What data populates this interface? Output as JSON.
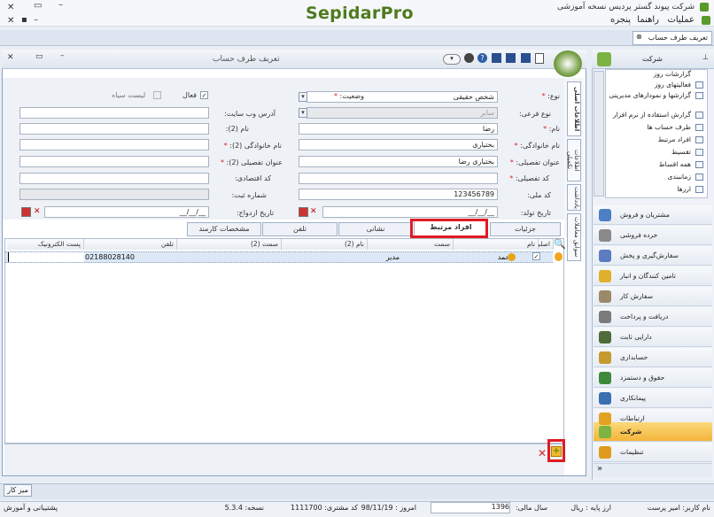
{
  "app": {
    "title": "شرکت پیوند گستر پردیس نسخه آموزشی",
    "brand": "SepidarPro"
  },
  "menu": {
    "ops": "عملیات",
    "help": "راهنما",
    "window": "پنجره"
  },
  "doc_tab": "تعریف طرف حساب",
  "window": {
    "title": "تعریف طرف حساب"
  },
  "form": {
    "type_label": "نوع:",
    "type_value": "شخص حقیقی",
    "subtype_label": "نوع فرعی:",
    "subtype_value": "سایر",
    "name_label": "نام:",
    "name_value": "رضا",
    "family_label": "نام خانوادگی:",
    "family_value": "بختیاری",
    "title_label": "عنوان تفصیلی:",
    "title_value": "بختیاری رضا",
    "detail_code_label": "کد تفصیلی:",
    "national_label": "کد ملی:",
    "national_value": "123456789",
    "birth_label": "تاریخ تولد:",
    "date_placeholder": "__/__/__",
    "status_label": "وضعیت:",
    "active_label": "فعال",
    "blacklist_label": "لیست سیاه",
    "website_label": "آدرس وب سایت:",
    "name2_label": "نام (2):",
    "family2_label": "نام خانوادگی (2):",
    "title2_label": "عنوان تفصیلی (2):",
    "econ_label": "کد اقتصادی:",
    "reg_label": "شماره ثبت:",
    "marriage_label": "تاریخ ازدواج:"
  },
  "vtabs": [
    "اطلاعات اصلی",
    "اطلاعات تکمیلی",
    "یادداشت",
    "سوابق معاملات"
  ],
  "tabs": [
    "جزئیات",
    "افراد مرتبط",
    "نشانی",
    "تلفن",
    "مشخصات کارمند"
  ],
  "grid": {
    "headers": [
      "اصلی",
      "نام",
      "سمت",
      "نام (2)",
      "سمت (2)",
      "تلفن",
      "پست الکترونیک"
    ],
    "row": {
      "name": "محمد",
      "role": "مدیر",
      "phone": "02188028140"
    }
  },
  "side": {
    "title": "شرکت",
    "tree": [
      "گزارشات روز",
      "فعالیتهای روز",
      "گزارشها و نمودارهای مدیریتی",
      "گزارش استفاده از نرم افزار",
      "طرف حساب ها",
      "افراد مرتبط",
      "تقسیط",
      "همه اقساط",
      "زمانبندی",
      "ارزها"
    ],
    "modules": [
      "مشتریان و فروش",
      "خرده فروشی",
      "سفارش‌گیری و پخش",
      "تامین کنندگان و انبار",
      "سفارش کار",
      "دریافت و پرداخت",
      "دارایی ثابت",
      "حسابداری",
      "حقوق و دستمزد",
      "پیمانکاری",
      "ارتباطات",
      "شرکت",
      "تنظیمات"
    ]
  },
  "desk": "میز کار",
  "status": {
    "user": "نام کاربر: امیر پرست",
    "currency": "ارز پایه : ریال",
    "fiscal": "سال مالی:",
    "year": "1396",
    "today": "امروز : 98/11/19",
    "customer": "کد مشتری: 1111700",
    "version": "نسخه: 5.3.4",
    "support": "پشتیبانی و آموزش"
  }
}
